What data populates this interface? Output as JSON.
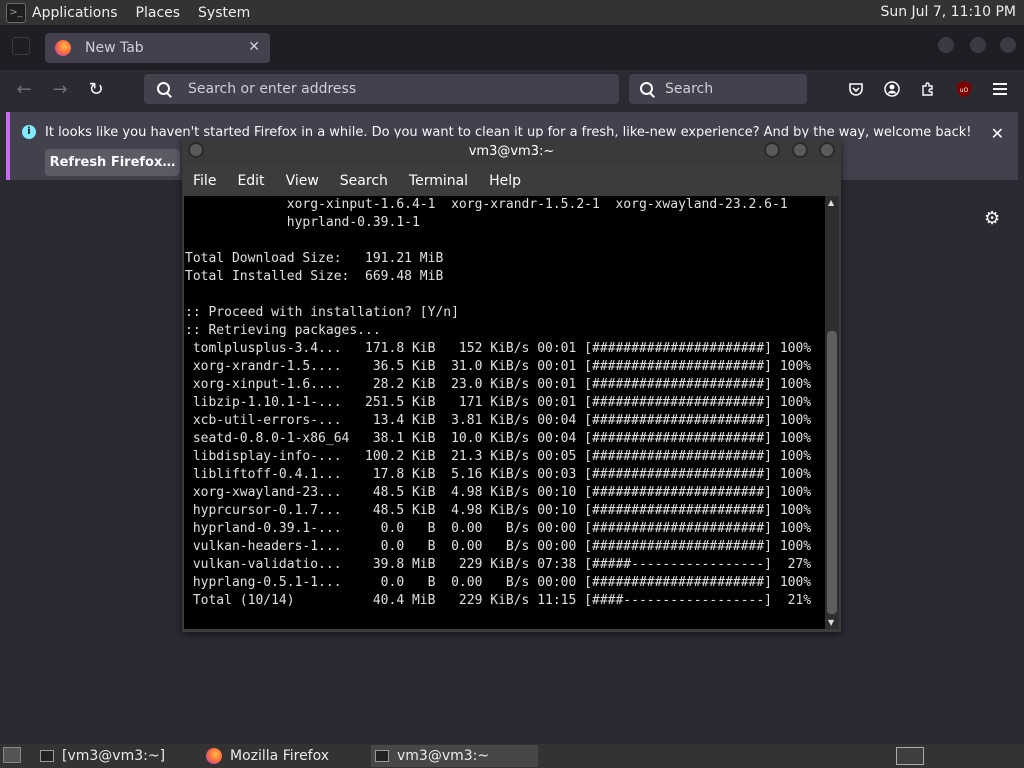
{
  "panel": {
    "menus": [
      "Applications",
      "Places",
      "System"
    ],
    "clock": "Sun Jul  7, 11:10 PM"
  },
  "firefox": {
    "tab_title": "New Tab",
    "url_placeholder": "Search or enter address",
    "search_placeholder": "Search",
    "notification": {
      "message": "It looks like you haven't started Firefox in a while. Do you want to clean it up for a fresh, like-new experience? And by the way, welcome back!",
      "button": "Refresh Firefox…"
    }
  },
  "terminal": {
    "title": "vm3@vm3:~",
    "menu": [
      "File",
      "Edit",
      "View",
      "Search",
      "Terminal",
      "Help"
    ],
    "lines": [
      "             xorg-xinput-1.6.4-1  xorg-xrandr-1.5.2-1  xorg-xwayland-23.2.6-1",
      "             hyprland-0.39.1-1",
      "",
      "Total Download Size:   191.21 MiB",
      "Total Installed Size:  669.48 MiB",
      "",
      ":: Proceed with installation? [Y/n]",
      ":: Retrieving packages...",
      " tomlplusplus-3.4...   171.8 KiB   152 KiB/s 00:01 [######################] 100%",
      " xorg-xrandr-1.5....    36.5 KiB  31.0 KiB/s 00:01 [######################] 100%",
      " xorg-xinput-1.6....    28.2 KiB  23.0 KiB/s 00:01 [######################] 100%",
      " libzip-1.10.1-1-...   251.5 KiB   171 KiB/s 00:01 [######################] 100%",
      " xcb-util-errors-...    13.4 KiB  3.81 KiB/s 00:04 [######################] 100%",
      " seatd-0.8.0-1-x86_64   38.1 KiB  10.0 KiB/s 00:04 [######################] 100%",
      " libdisplay-info-...   100.2 KiB  21.3 KiB/s 00:05 [######################] 100%",
      " libliftoff-0.4.1...    17.8 KiB  5.16 KiB/s 00:03 [######################] 100%",
      " xorg-xwayland-23...    48.5 KiB  4.98 KiB/s 00:10 [######################] 100%",
      " hyprcursor-0.1.7...    48.5 KiB  4.98 KiB/s 00:10 [######################] 100%",
      " hyprland-0.39.1-...     0.0   B  0.00   B/s 00:00 [######################] 100%",
      " vulkan-headers-1...     0.0   B  0.00   B/s 00:00 [######################] 100%",
      " vulkan-validatio...    39.8 MiB   229 KiB/s 07:38 [#####-----------------]  27%",
      " hyprlang-0.5.1-1...     0.0   B  0.00   B/s 00:00 [######################] 100%",
      " Total (10/14)          40.4 MiB   229 KiB/s 11:15 [####------------------]  21%"
    ]
  },
  "taskbar": {
    "items": [
      "[vm3@vm3:~]",
      "Mozilla Firefox",
      "vm3@vm3:~"
    ]
  }
}
